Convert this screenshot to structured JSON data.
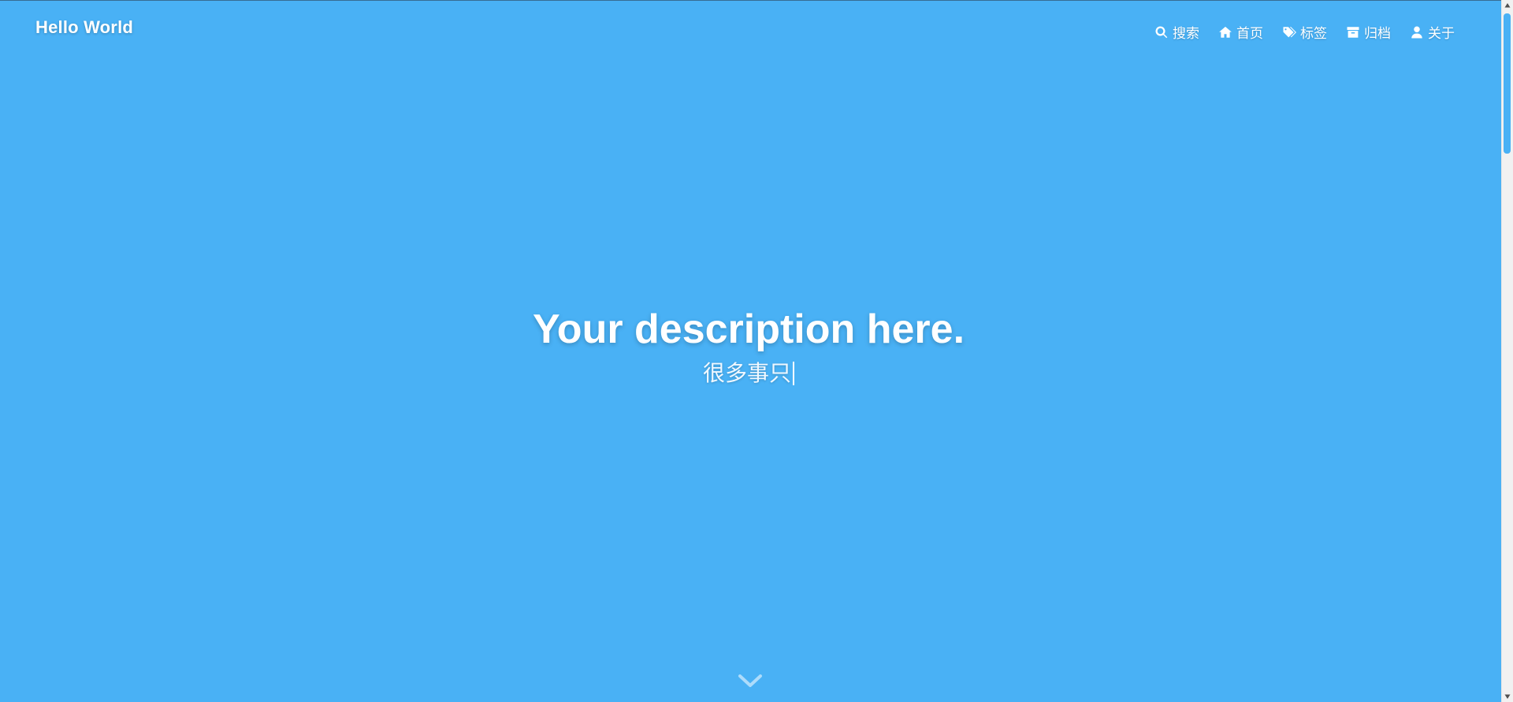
{
  "header": {
    "site_title": "Hello World",
    "menu": [
      {
        "label": "搜索",
        "icon": "search-icon"
      },
      {
        "label": "首页",
        "icon": "home-icon"
      },
      {
        "label": "标签",
        "icon": "tags-icon"
      },
      {
        "label": "归档",
        "icon": "archive-icon"
      },
      {
        "label": "关于",
        "icon": "user-icon"
      }
    ]
  },
  "hero": {
    "title": "Your description here.",
    "subtitle": "很多事只"
  },
  "scroll_down": {
    "icon": "chevron-down-icon"
  },
  "colors": {
    "background": "#49b1f5",
    "text": "#ffffff",
    "scroll_thumb": "#49b1f5"
  }
}
